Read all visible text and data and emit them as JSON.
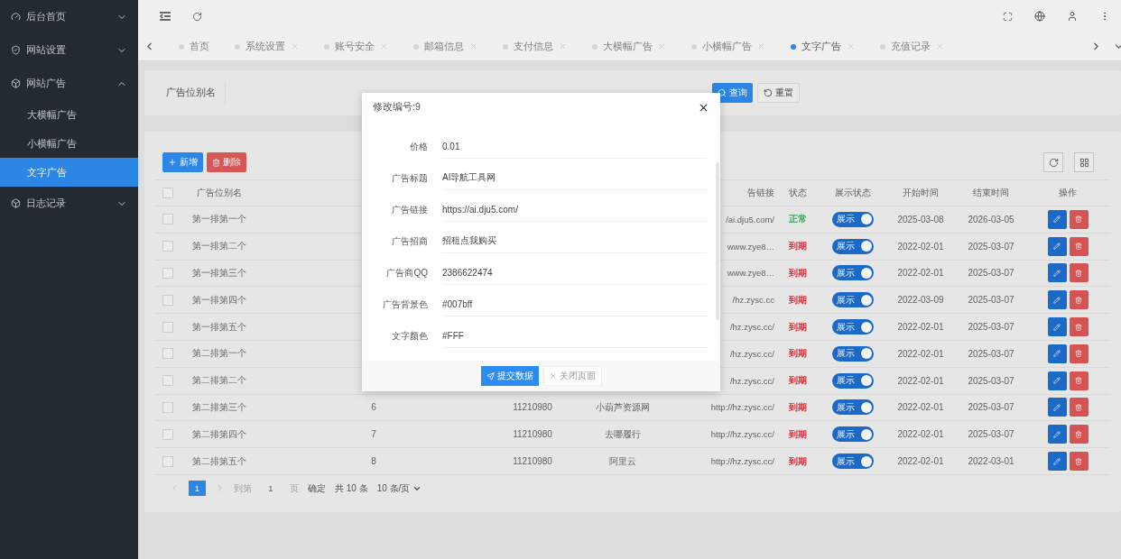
{
  "sidebar": {
    "items": [
      {
        "label": "后台首页",
        "expanded": false
      },
      {
        "label": "网站设置",
        "expanded": false
      },
      {
        "label": "网站广告",
        "expanded": true,
        "children": [
          {
            "label": "大横幅广告",
            "selected": false
          },
          {
            "label": "小横幅广告",
            "selected": false
          },
          {
            "label": "文字广告",
            "selected": true
          }
        ]
      },
      {
        "label": "日志记录",
        "expanded": false
      }
    ]
  },
  "tabs": [
    {
      "label": "首页",
      "selected": false,
      "closable": false
    },
    {
      "label": "系统设置",
      "selected": false,
      "closable": true
    },
    {
      "label": "账号安全",
      "selected": false,
      "closable": true
    },
    {
      "label": "邮箱信息",
      "selected": false,
      "closable": true
    },
    {
      "label": "支付信息",
      "selected": false,
      "closable": true
    },
    {
      "label": "大横幅广告",
      "selected": false,
      "closable": true
    },
    {
      "label": "小横幅广告",
      "selected": false,
      "closable": true
    },
    {
      "label": "文字广告",
      "selected": true,
      "closable": true
    },
    {
      "label": "充值记录",
      "selected": false,
      "closable": true
    }
  ],
  "search": {
    "field_label": "广告位别名",
    "buttons": [
      {
        "kind": "primary",
        "label": "查询"
      },
      {
        "kind": "reset",
        "label": "重置"
      }
    ]
  },
  "toolbar": {
    "buttons": [
      {
        "kind": "add",
        "label": "新增"
      },
      {
        "kind": "delete",
        "label": "删除"
      }
    ]
  },
  "table": {
    "header_checked": false,
    "columns": [
      "广告位别名",
      "告链接",
      "状态",
      "展示状态",
      "开始时间",
      "结束时间",
      "操作"
    ],
    "rows": [
      {
        "checked": false,
        "name": "第一排第一个",
        "link": "/ai.dju5.com/",
        "status": "正常",
        "color": "#3aa757",
        "show_label": "展示",
        "show_on": true,
        "start": "2025-03-08",
        "end": "2026-03-05"
      },
      {
        "checked": false,
        "name": "第一排第二个",
        "link": "www.zye8…",
        "status": "到期",
        "color": "#d9363e",
        "show_label": "展示",
        "show_on": true,
        "start": "2022-02-01",
        "end": "2025-03-07"
      },
      {
        "checked": false,
        "name": "第一排第三个",
        "link": "www.zye8…",
        "status": "到期",
        "color": "#d9363e",
        "show_label": "展示",
        "show_on": true,
        "start": "2022-02-01",
        "end": "2025-03-07"
      },
      {
        "checked": false,
        "name": "第一排第四个",
        "link": "/hz.zysc.cc",
        "status": "到期",
        "color": "#d9363e",
        "show_label": "展示",
        "show_on": true,
        "start": "2022-03-09",
        "end": "2025-03-07"
      },
      {
        "checked": false,
        "name": "第一排第五个",
        "link": "/hz.zysc.cc/",
        "status": "到期",
        "color": "#d9363e",
        "show_label": "展示",
        "show_on": true,
        "start": "2022-02-01",
        "end": "2025-03-07"
      },
      {
        "checked": false,
        "name": "第二排第一个",
        "link": "/hz.zysc.cc/",
        "status": "到期",
        "color": "#d9363e",
        "show_label": "展示",
        "show_on": true,
        "start": "2022-02-01",
        "end": "2025-03-07"
      },
      {
        "checked": false,
        "name": "第二排第二个",
        "link": "/hz.zysc.cc/",
        "status": "到期",
        "color": "#d9363e",
        "show_label": "展示",
        "show_on": true,
        "start": "2022-02-01",
        "end": "2025-03-07"
      },
      {
        "checked": false,
        "name": "第二排第三个",
        "column_2": "6",
        "column_3": "11210980",
        "column_4": "小葫芦资源网",
        "link": "http://hz.zysc.cc/",
        "status": "到期",
        "color": "#d9363e",
        "show_label": "展示",
        "show_on": true,
        "start": "2022-02-01",
        "end": "2025-03-07"
      },
      {
        "checked": false,
        "name": "第二排第四个",
        "column_2": "7",
        "column_3": "11210980",
        "column_4": "去哪履行",
        "link": "http://hz.zysc.cc/",
        "status": "到期",
        "color": "#d9363e",
        "show_label": "展示",
        "show_on": true,
        "start": "2022-02-01",
        "end": "2025-03-07"
      },
      {
        "checked": false,
        "name": "第二排第五个",
        "column_2": "8",
        "column_3": "11210980",
        "column_4": "阿里云",
        "link": "http://hz.zysc.cc/",
        "status": "到期",
        "color": "#d9363e",
        "show_label": "展示",
        "show_on": true,
        "start": "2022-02-01",
        "end": "2022-03-01"
      }
    ]
  },
  "pagination": {
    "pages": [
      {
        "label": "1",
        "selected": true
      }
    ],
    "goto_label": "到第",
    "goto_value": "1",
    "page_unit": "页",
    "confirm": "确定",
    "total": "共 10 条",
    "page_size": "10 条/页"
  },
  "modal": {
    "title": "修改编号:9",
    "fields": [
      {
        "label": "价格",
        "value": "0.01"
      },
      {
        "label": "广告标题",
        "value": "AI导航工具网"
      },
      {
        "label": "广告链接",
        "value": "https://ai.dju5.com/"
      },
      {
        "label": "广告招商",
        "value": "招租点我购买"
      },
      {
        "label": "广告商QQ",
        "value": "2386622474"
      },
      {
        "label": "广告背景色",
        "value": "#007bff"
      },
      {
        "label": "文字颜色",
        "value": "#FFF"
      }
    ],
    "submit": "提交数据",
    "close": "关闭页面"
  }
}
